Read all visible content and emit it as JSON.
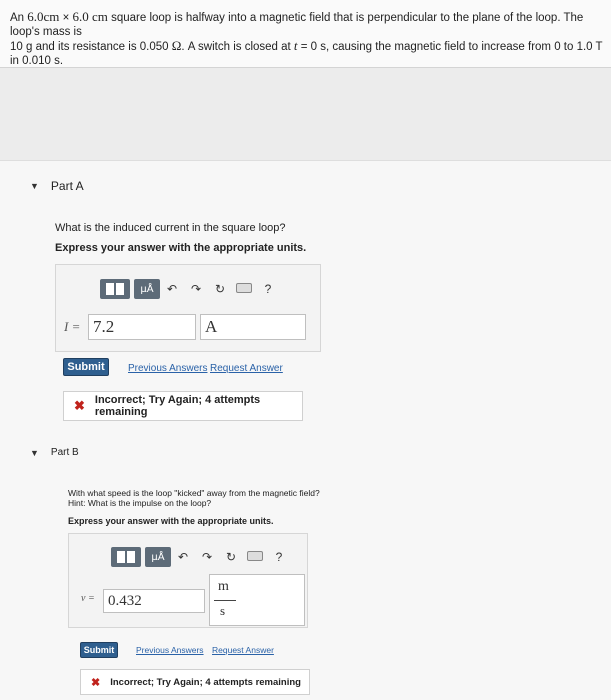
{
  "problem": {
    "line1_a": "An ",
    "line1_m1": "6.0cm",
    "line1_b": " × ",
    "line1_m2": "6.0 cm",
    "line1_c": " square loop is halfway into a magnetic field that is perpendicular to the plane of the loop. The loop's mass is",
    "line2_a": "10 g and its resistance is 0.050 ",
    "line2_omega": "Ω",
    "line2_b": ". A switch is closed at ",
    "line2_t": "t",
    "line2_eq": " = ",
    "line2_c": "0 s, causing the magnetic field to increase from 0 to 1.0 T in 0.010 s."
  },
  "partA": {
    "label": "Part A",
    "question": "What is the induced current in the square loop?",
    "instruction": "Express your answer with the appropriate units.",
    "toolbar_mu": "μÅ",
    "toolbar_help": "?",
    "var_label": "I =",
    "value": "7.2",
    "unit": "A",
    "submit": "Submit",
    "prev_answers": "Previous Answers",
    "request_answer": "Request Answer",
    "feedback": "Incorrect; Try Again; 4 attempts remaining"
  },
  "partB": {
    "label": "Part B",
    "question": "With what speed is the loop \"kicked\" away from the magnetic field?",
    "hint": "Hint: What is the impulse on the loop?",
    "instruction": "Express your answer with the appropriate units.",
    "toolbar_mu": "μÅ",
    "toolbar_help": "?",
    "var_label": "v =",
    "value": "0.432",
    "unit_num": "m",
    "unit_den": "s",
    "submit": "Submit",
    "prev_answers": "Previous Answers",
    "request_answer": "Request Answer",
    "feedback": "Incorrect; Try Again; 4 attempts remaining"
  }
}
